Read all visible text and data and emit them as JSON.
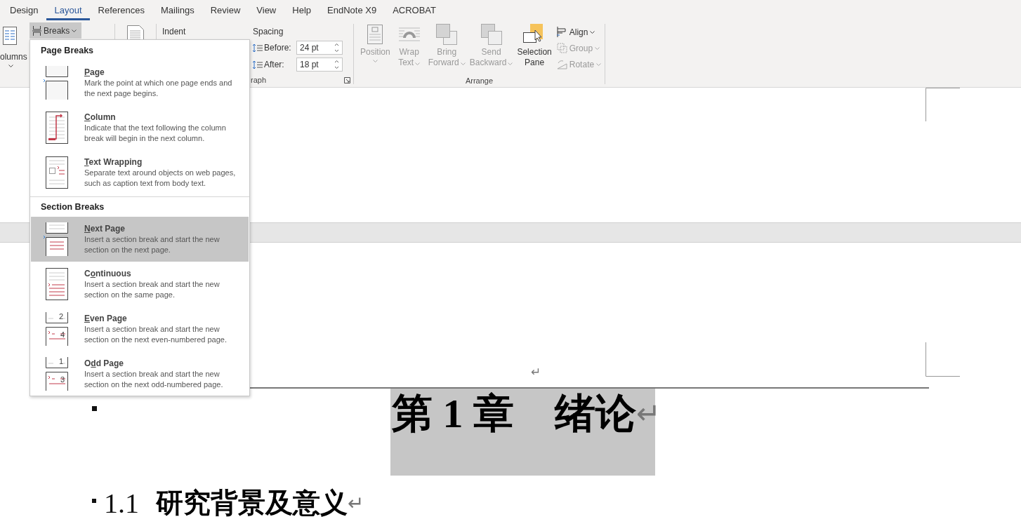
{
  "tabs": [
    {
      "label": "Design",
      "selected": false
    },
    {
      "label": "Layout",
      "selected": true
    },
    {
      "label": "References",
      "selected": false
    },
    {
      "label": "Mailings",
      "selected": false
    },
    {
      "label": "Review",
      "selected": false
    },
    {
      "label": "View",
      "selected": false
    },
    {
      "label": "Help",
      "selected": false
    },
    {
      "label": "EndNote X9",
      "selected": false
    },
    {
      "label": "ACROBAT",
      "selected": false
    }
  ],
  "ribbon": {
    "columns": {
      "label": "olumns"
    },
    "breaks": {
      "label": "Breaks",
      "selected": true
    },
    "paragraph": {
      "indent_label": "Indent",
      "spacing_label": "Spacing",
      "group_label": "raph",
      "fields": [
        {
          "label": "Before:",
          "value": "24 pt"
        },
        {
          "label": "After:",
          "value": "18 pt"
        }
      ]
    },
    "arrange": {
      "group_label": "Arrange",
      "large_buttons": [
        {
          "kind": "position",
          "lines": [
            "Position"
          ],
          "disabled": true,
          "dropdown": true
        },
        {
          "kind": "wrap",
          "lines": [
            "Wrap",
            "Text"
          ],
          "disabled": true,
          "dropdown": true
        },
        {
          "kind": "bring",
          "lines": [
            "Bring",
            "Forward"
          ],
          "disabled": true,
          "dropdown": true
        },
        {
          "kind": "send",
          "lines": [
            "Send",
            "Backward"
          ],
          "disabled": true,
          "dropdown": true
        },
        {
          "kind": "selection",
          "lines": [
            "Selection",
            "Pane"
          ],
          "disabled": false,
          "dropdown": false
        }
      ],
      "small_buttons": [
        {
          "kind": "align",
          "label": "Align",
          "disabled": false
        },
        {
          "kind": "group",
          "label": "Group",
          "disabled": true
        },
        {
          "kind": "rotate",
          "label": "Rotate",
          "disabled": true
        }
      ]
    }
  },
  "breaks_menu": [
    {
      "title": "Page Breaks",
      "items": [
        {
          "kind": "page",
          "key": "P",
          "post": "age",
          "description": "Mark the point at which one page ends and the next page begins.",
          "selected": false
        },
        {
          "kind": "column",
          "key": "C",
          "post": "olumn",
          "description": "Indicate that the text following the column break will begin in the next column.",
          "selected": false
        },
        {
          "kind": "wrapping",
          "key": "T",
          "post": "ext Wrapping",
          "description": "Separate text around objects on web pages, such as caption text from body text.",
          "selected": false
        }
      ]
    },
    {
      "title": "Section Breaks",
      "items": [
        {
          "kind": "next",
          "key": "N",
          "post": "ext Page",
          "description": "Insert a section break and start the new section on the next page.",
          "selected": true
        },
        {
          "kind": "continuous",
          "pre": "C",
          "key": "o",
          "post": "ntinuous",
          "description": "Insert a section break and start the new section on the same page.",
          "selected": false
        },
        {
          "kind": "numbered",
          "key": "E",
          "post": "ven Page",
          "description": "Insert a section break and start the new section on the next even-numbered page.",
          "numbers": [
            "2",
            "4"
          ],
          "selected": false
        },
        {
          "kind": "numbered",
          "pre": "O",
          "key": "d",
          "post": "d Page",
          "description": "Insert a section break and start the new section on the next odd-numbered page.",
          "numbers": [
            "1",
            "3"
          ],
          "selected": false
        }
      ]
    }
  ],
  "document": {
    "empty_paragraph_mark": "↵",
    "heading": {
      "text": "第 1 章　绪论",
      "mark": "↵",
      "highlighted": true
    },
    "subheading": {
      "number": "1.1",
      "text": "研究背景及意义",
      "mark": "↵"
    }
  }
}
